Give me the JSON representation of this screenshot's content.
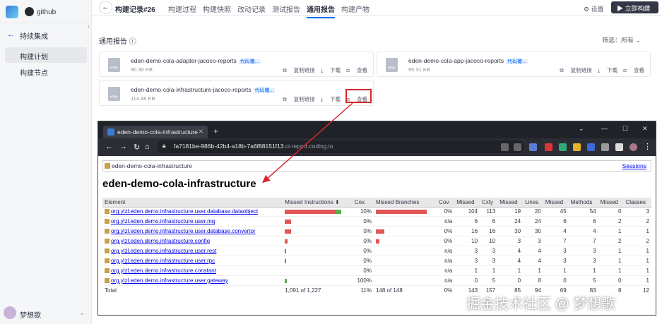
{
  "sidebar": {
    "project": "github",
    "back_label": "持续集成",
    "items": [
      {
        "label": "构建计划",
        "active": true
      },
      {
        "label": "构建节点",
        "active": false
      }
    ],
    "user": "梦想歌"
  },
  "topbar": {
    "title": "构建记录#26",
    "tabs": [
      {
        "label": "构建过程",
        "active": false
      },
      {
        "label": "构建快照",
        "active": false
      },
      {
        "label": "改动记录",
        "active": false
      },
      {
        "label": "测试报告",
        "active": false
      },
      {
        "label": "通用报告",
        "active": true
      },
      {
        "label": "构建产物",
        "active": false
      }
    ],
    "settings_label": "设置",
    "build_button": "立即构建"
  },
  "reports": {
    "title": "通用报告",
    "filter": "筛选：所有",
    "cards": [
      {
        "icon": "HTML",
        "name": "eden-demo-cola-adapter-jacoco-reports",
        "tag": "代码覆...",
        "size": "90.30 KB"
      },
      {
        "icon": "HTML",
        "name": "eden-demo-cola-app-jacoco-reports",
        "tag": "代码覆...",
        "size": "95.31 KB"
      },
      {
        "icon": "HTML",
        "name": "eden-demo-cola-infrastructure-jacoco-reports",
        "tag": "代码覆...",
        "size": "114.46 KB"
      }
    ],
    "actions": {
      "copy": "复制链接",
      "download": "下载",
      "view": "查看"
    }
  },
  "browser": {
    "tab_title": "eden-demo-cola-infrastructure",
    "url_host": "fa7181be-986b-42b4-a18b-7a6f88151f13",
    "url_rest": ".ci-report.coding.io",
    "breadcrumb": "eden-demo-cola-infrastructure",
    "sessions": "Sessions",
    "heading": "eden-demo-cola-infrastructure",
    "columns": [
      "Element",
      "Missed Instructions",
      "Cov.",
      "Missed Branches",
      "Cov.",
      "Missed",
      "Cxty",
      "Missed",
      "Lines",
      "Missed",
      "Methods",
      "Missed",
      "Classes"
    ],
    "rows": [
      {
        "element": "org.ylzl.eden.demo.infrastructure.user.database.dataobject",
        "instr_missed_frac": 0.9,
        "instr_covered_frac": 0.1,
        "cov": "10%",
        "br_missed_frac": 1.0,
        "br_cov": "0%",
        "v": [
          "104",
          "113",
          "19",
          "20",
          "45",
          "54",
          "0",
          "3"
        ]
      },
      {
        "element": "org.ylzl.eden.demo.infrastructure.user.mq",
        "instr_missed_frac": 0.11,
        "instr_covered_frac": 0,
        "cov": "0%",
        "br_missed_frac": 0,
        "br_cov": "n/a",
        "v": [
          "6",
          "6",
          "24",
          "24",
          "6",
          "6",
          "2",
          "2"
        ]
      },
      {
        "element": "org.ylzl.eden.demo.infrastructure.user.database.convertor",
        "instr_missed_frac": 0.11,
        "instr_covered_frac": 0,
        "cov": "0%",
        "br_missed_frac": 0.17,
        "br_cov": "0%",
        "v": [
          "16",
          "16",
          "30",
          "30",
          "4",
          "4",
          "1",
          "1"
        ]
      },
      {
        "element": "org.ylzl.eden.demo.infrastructure.config",
        "instr_missed_frac": 0.05,
        "instr_covered_frac": 0,
        "cov": "0%",
        "br_missed_frac": 0.07,
        "br_cov": "0%",
        "v": [
          "10",
          "10",
          "3",
          "3",
          "7",
          "7",
          "2",
          "2"
        ]
      },
      {
        "element": "org.ylzl.eden.demo.infrastructure.user.rest",
        "instr_missed_frac": 0.01,
        "instr_covered_frac": 0,
        "cov": "0%",
        "br_missed_frac": 0,
        "br_cov": "n/a",
        "v": [
          "3",
          "3",
          "4",
          "4",
          "3",
          "3",
          "1",
          "1"
        ]
      },
      {
        "element": "org.ylzl.eden.demo.infrastructure.user.rpc",
        "instr_missed_frac": 0.01,
        "instr_covered_frac": 0,
        "cov": "0%",
        "br_missed_frac": 0,
        "br_cov": "n/a",
        "v": [
          "3",
          "3",
          "4",
          "4",
          "3",
          "3",
          "1",
          "1"
        ]
      },
      {
        "element": "org.ylzl.eden.demo.infrastructure.constant",
        "instr_missed_frac": 0,
        "instr_covered_frac": 0,
        "cov": "0%",
        "br_missed_frac": 0,
        "br_cov": "n/a",
        "v": [
          "1",
          "1",
          "1",
          "1",
          "1",
          "1",
          "1",
          "1"
        ]
      },
      {
        "element": "org.ylzl.eden.demo.infrastructure.user.gateway",
        "instr_missed_frac": 0,
        "instr_covered_frac": 0.04,
        "cov": "100%",
        "br_missed_frac": 0,
        "br_cov": "n/a",
        "v": [
          "0",
          "5",
          "0",
          "8",
          "0",
          "5",
          "0",
          "1"
        ]
      }
    ],
    "total": {
      "label": "Total",
      "instr": "1,091 of 1,227",
      "cov": "11%",
      "br": "148 of 148",
      "br_cov": "0%",
      "v": [
        "143",
        "157",
        "85",
        "94",
        "69",
        "83",
        "8",
        "12"
      ]
    }
  },
  "watermark": "掘金技术社区 @ 梦想歌",
  "colors": {
    "accent": "#0066ff",
    "highlight": "#d8282c",
    "missed": "#e05555",
    "covered": "#55b04a"
  }
}
